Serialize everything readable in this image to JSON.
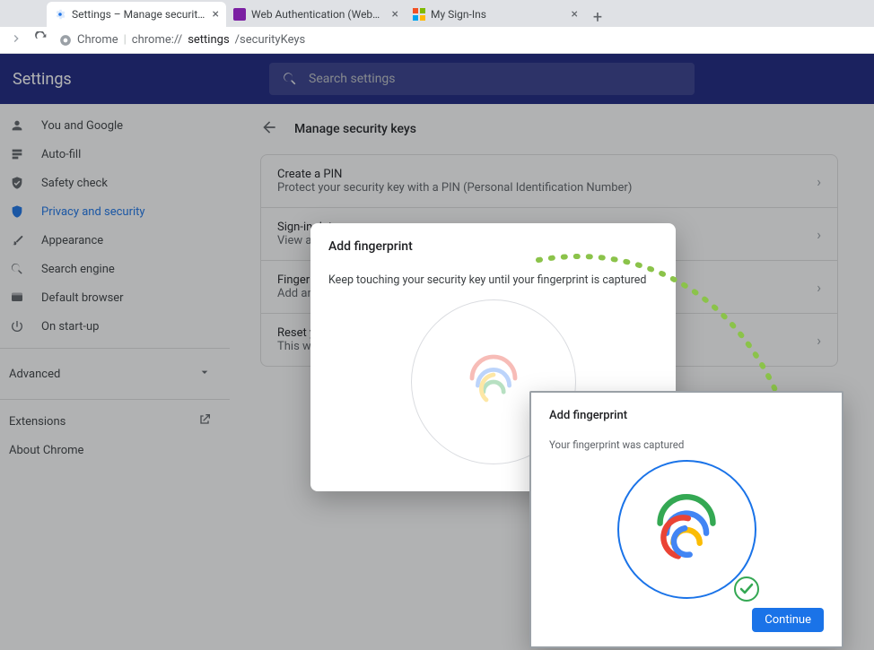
{
  "browser": {
    "tabs": [
      {
        "title": "Settings – Manage security keys",
        "active": true,
        "favicon": "gear-blue"
      },
      {
        "title": "Web Authentication (WebAuthn)",
        "active": false,
        "favicon": "purple-square"
      },
      {
        "title": "My Sign-Ins",
        "active": false,
        "favicon": "ms-logo"
      }
    ],
    "address": {
      "scheme": "Chrome",
      "host": "chrome://",
      "path_strong": "settings",
      "path_rest": "/securityKeys"
    }
  },
  "settings": {
    "brand": "Settings",
    "search_placeholder": "Search settings",
    "sidebar": {
      "items": [
        {
          "label": "You and Google",
          "icon": "person"
        },
        {
          "label": "Auto-fill",
          "icon": "autofill"
        },
        {
          "label": "Safety check",
          "icon": "shield-check"
        },
        {
          "label": "Privacy and security",
          "icon": "shield",
          "selected": true
        },
        {
          "label": "Appearance",
          "icon": "brush"
        },
        {
          "label": "Search engine",
          "icon": "search"
        },
        {
          "label": "Default browser",
          "icon": "browser"
        },
        {
          "label": "On start-up",
          "icon": "power"
        }
      ],
      "advanced": "Advanced",
      "extensions": "Extensions",
      "about": "About Chrome"
    },
    "page": {
      "title": "Manage security keys",
      "rows": [
        {
          "title": "Create a PIN",
          "sub": "Protect your security key with a PIN (Personal Identification Number)"
        },
        {
          "title": "Sign-in data",
          "sub": "View and delete sign-in data stored on your security key"
        },
        {
          "title": "Fingerprints",
          "sub": "Add and delete fingerprints saved on your security key"
        },
        {
          "title": "Reset your security key",
          "sub": "This will delete all data on the security key, including its PIN"
        }
      ]
    }
  },
  "dialog_capture": {
    "title": "Add fingerprint",
    "body": "Keep touching your security key until your fingerprint is captured"
  },
  "dialog_done": {
    "title": "Add fingerprint",
    "body": "Your fingerprint was captured",
    "continue": "Continue"
  }
}
